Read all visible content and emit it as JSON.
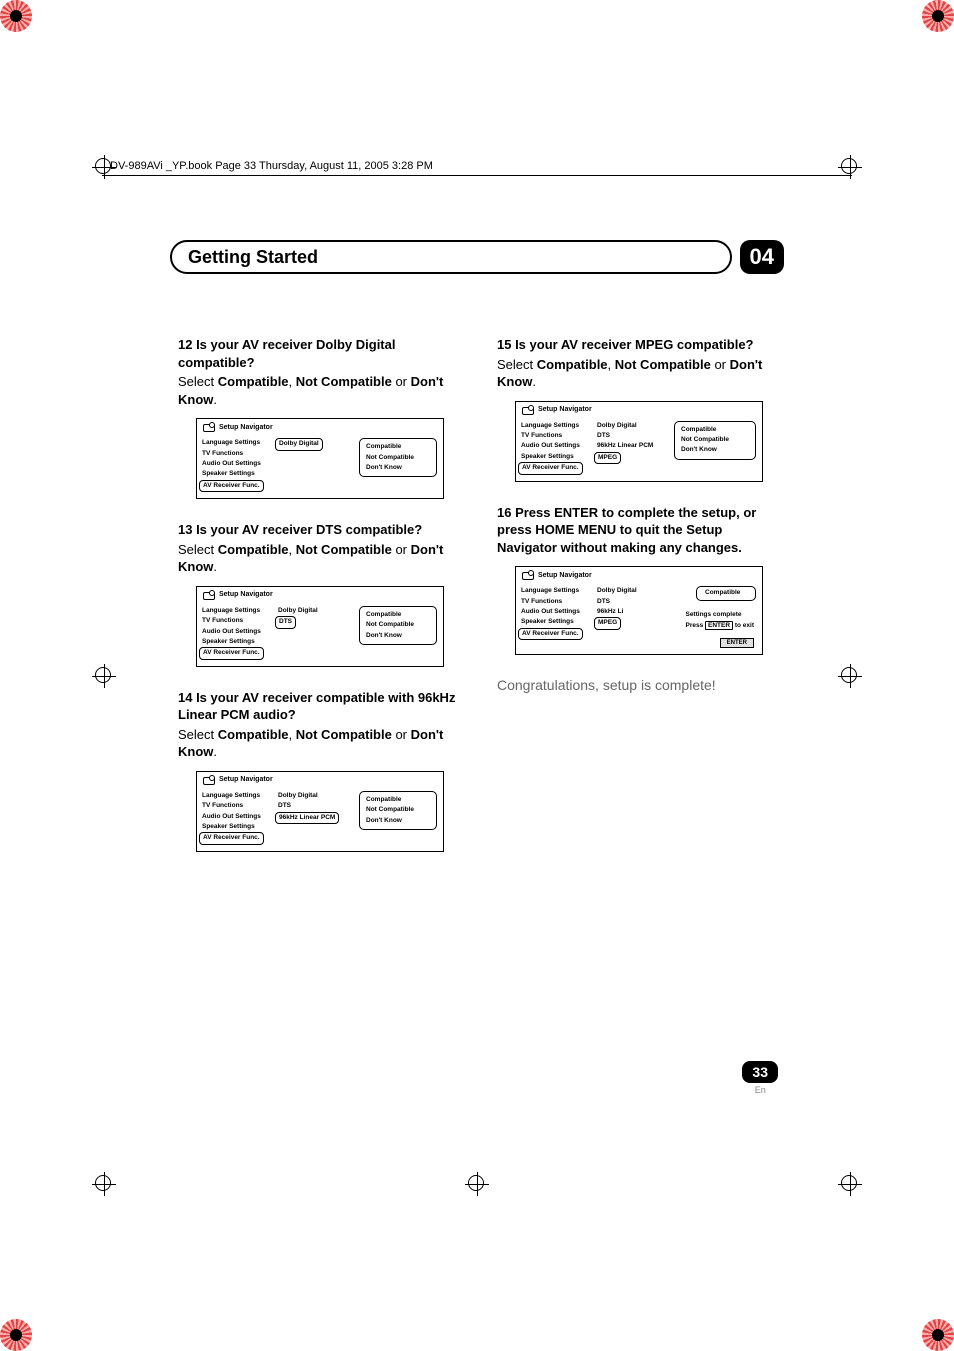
{
  "bookmark": "DV-989AVi _YP.book  Page 33  Thursday, August 11, 2005  3:28 PM",
  "header": {
    "title": "Getting Started",
    "chapter": "04"
  },
  "nav": {
    "title": "Setup Navigator",
    "left": [
      "Language Settings",
      "TV Functions",
      "Audio Out Settings",
      "Speaker Settings",
      "AV Receiver Func."
    ],
    "options": [
      "Compatible",
      "Not Compatible",
      "Don't Know"
    ],
    "formats": {
      "dd": "Dolby Digital",
      "dts": "DTS",
      "pcm": "96kHz Linear PCM",
      "pcm_short": "96kHz Li",
      "mpeg": "MPEG"
    }
  },
  "steps": {
    "s12": {
      "title": "12  Is your AV receiver Dolby Digital compatible?",
      "body_pre": "Select ",
      "b1": "Compatible",
      "sep1": ", ",
      "b2": "Not Compatible",
      "sep2": " or ",
      "b3": "Don't Know",
      "tail": "."
    },
    "s13": {
      "title": "13  Is your AV receiver DTS compatible?",
      "body_pre": "Select ",
      "b1": "Compatible",
      "sep1": ", ",
      "b2": "Not Compatible",
      "sep2": " or ",
      "b3": "Don't Know",
      "tail": "."
    },
    "s14": {
      "title": "14  Is your AV receiver compatible with 96kHz Linear PCM audio?",
      "body_pre": "Select ",
      "b1": "Compatible",
      "sep1": ", ",
      "b2": "Not Compatible",
      "sep2": " or ",
      "b3": "Don't Know",
      "tail": "."
    },
    "s15": {
      "title": "15  Is your AV receiver MPEG compatible?",
      "body_pre": "Select ",
      "b1": "Compatible",
      "sep1": ", ",
      "b2": "Not Compatible",
      "sep2": " or ",
      "b3": "Don't Know",
      "tail": "."
    },
    "s16": {
      "title": "16  Press ENTER to complete the setup, or press HOME MENU to quit the Setup Navigator without making any changes.",
      "msg1": "Settings complete",
      "msg2_pre": "Press ",
      "msg2_key": "ENTER",
      "msg2_post": " to exit",
      "enter": "ENTER"
    }
  },
  "congrats": "Congratulations, setup is complete!",
  "footer": {
    "page": "33",
    "lang": "En"
  }
}
